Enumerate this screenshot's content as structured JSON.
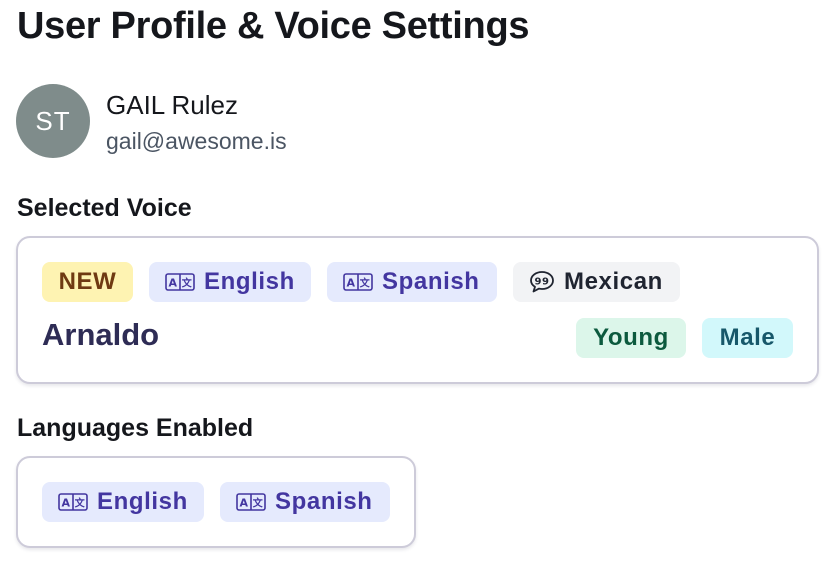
{
  "page": {
    "title": "User Profile & Voice Settings"
  },
  "user": {
    "initials": "ST",
    "name": "GAIL Rulez",
    "email": "gail@awesome.is",
    "avatar_color": "#7f8c8b"
  },
  "selected_voice": {
    "section_label": "Selected Voice",
    "badge": "NEW",
    "languages": [
      {
        "label": "English",
        "icon": "language-translate-icon"
      },
      {
        "label": "Spanish",
        "icon": "language-translate-icon"
      }
    ],
    "accent": {
      "label": "Mexican",
      "icon": "speech-bubble-quote-icon"
    },
    "name": "Arnaldo",
    "age": "Young",
    "gender": "Male"
  },
  "languages_enabled": {
    "section_label": "Languages Enabled",
    "items": [
      {
        "label": "English",
        "icon": "language-translate-icon"
      },
      {
        "label": "Spanish",
        "icon": "language-translate-icon"
      }
    ]
  },
  "colors": {
    "new_badge_bg": "#fef3b2",
    "language_chip_bg": "#e5eafd",
    "language_chip_text": "#4336a0",
    "age_chip_bg": "#dcf6ea",
    "gender_chip_bg": "#d2f8fb"
  }
}
